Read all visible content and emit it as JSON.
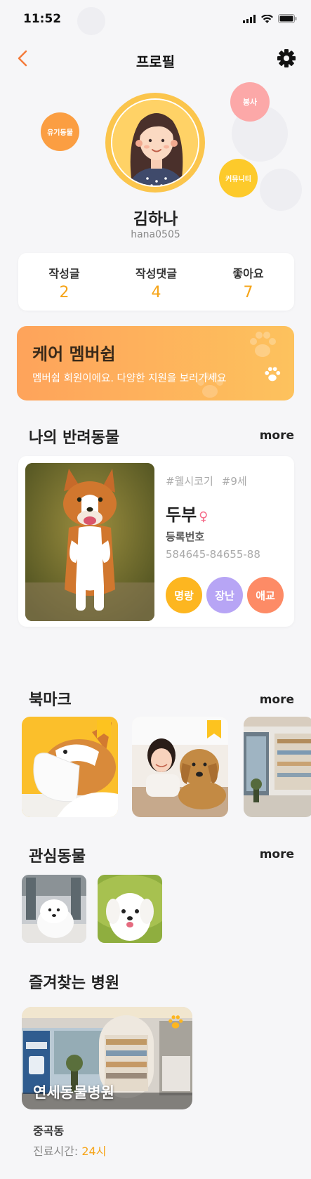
{
  "status_bar": {
    "time": "11:52"
  },
  "header": {
    "title": "프로필"
  },
  "profile": {
    "name": "김하나",
    "user_id": "hana0505",
    "bubbles": [
      "유기동물",
      "봉사",
      "커뮤니티"
    ]
  },
  "stats": [
    {
      "label": "작성글",
      "value": "2"
    },
    {
      "label": "작성댓글",
      "value": "4"
    },
    {
      "label": "좋아요",
      "value": "7"
    }
  ],
  "membership": {
    "title": "케어 멤버쉽",
    "subtitle": "멤버쉽 회원이에요. 다양한 지원을 보러가세요"
  },
  "my_pets": {
    "title": "나의 반려동물",
    "more": "more",
    "pet": {
      "breed_tag": "#웰시코기",
      "age_tag": "#9세",
      "name": "두부",
      "gender_symbol": "♀",
      "reg_label": "등록번호",
      "reg_number": "584645-84655-88",
      "traits": [
        "명랑",
        "장난",
        "애교"
      ]
    }
  },
  "bookmarks": {
    "title": "북마크",
    "more": "more"
  },
  "interest_animals": {
    "title": "관심동물",
    "more": "more"
  },
  "favorite_hospital": {
    "title": "즐겨찾는 병원",
    "name": "연세동물병원",
    "area": "중곡동",
    "hours_label": "진료시간: ",
    "hours_value": "24시"
  },
  "colors": {
    "accent": "#f6a417",
    "back_arrow": "#f47c3c",
    "membership_start": "#fea35b",
    "membership_end": "#fdc25d"
  }
}
